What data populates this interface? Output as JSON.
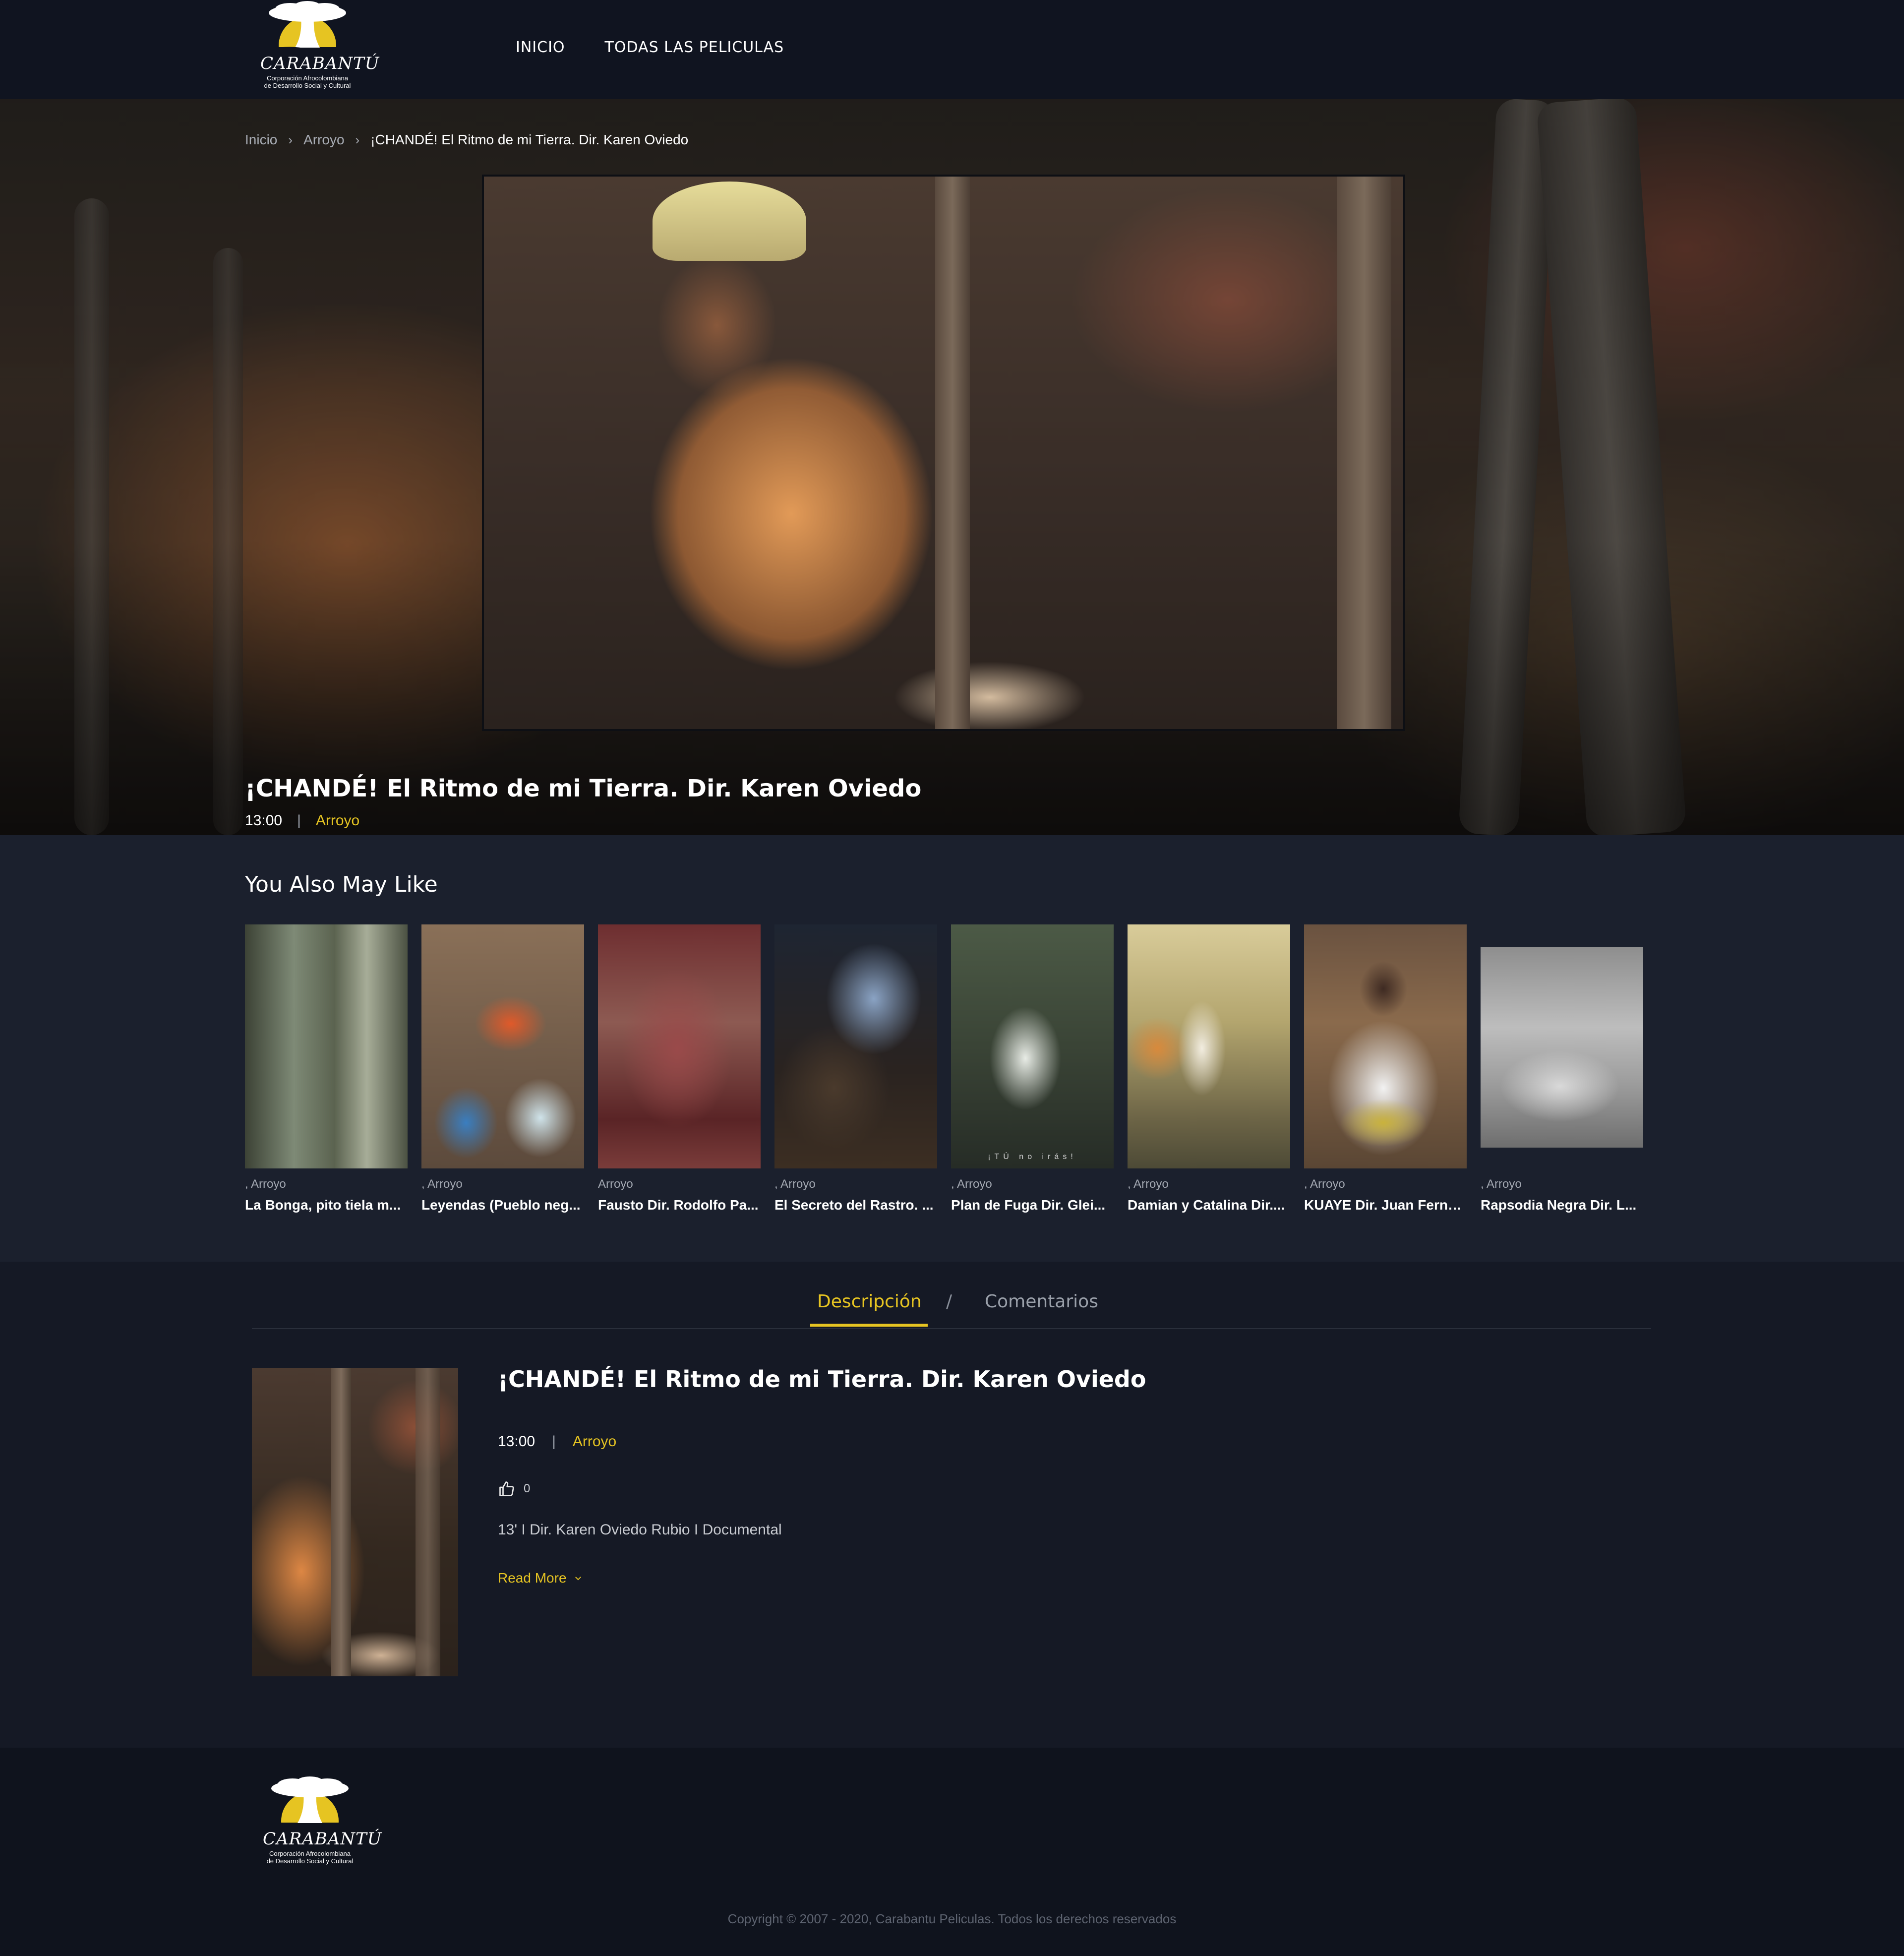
{
  "brand": {
    "name": "CARABANTÚ",
    "tagline_line1": "Corporación Afrocolombiana",
    "tagline_line2": "de Desarrollo Social y Cultural"
  },
  "nav": {
    "items": [
      "INICIO",
      "TODAS LAS PELICULAS"
    ]
  },
  "breadcrumb": {
    "items": [
      "Inicio",
      "Arroyo",
      "¡CHANDÉ! El Ritmo de mi Tierra. Dir. Karen Oviedo"
    ],
    "separator": "›"
  },
  "hero": {
    "title": "¡CHANDÉ! El Ritmo de mi Tierra. Dir. Karen Oviedo",
    "duration": "13:00",
    "separator": "|",
    "category": "Arroyo"
  },
  "related": {
    "heading": "You Also May Like",
    "items": [
      {
        "category": ", Arroyo",
        "title": "La Bonga, pito tiela m..."
      },
      {
        "category": ", Arroyo",
        "title": "Leyendas (Pueblo neg..."
      },
      {
        "category": "Arroyo",
        "title": "Fausto Dir. Rodolfo Pa..."
      },
      {
        "category": ", Arroyo",
        "title": "El Secreto del Rastro. ..."
      },
      {
        "category": ", Arroyo",
        "title": "Plan de Fuga Dir. Glei..."
      },
      {
        "category": ", Arroyo",
        "title": "Damian y Catalina Dir...."
      },
      {
        "category": ", Arroyo",
        "title": "KUAYE Dir. Juan Ferna..."
      },
      {
        "category": ", Arroyo",
        "title": "Rapsodia Negra Dir. L..."
      }
    ],
    "overlay_text": "¡TÚ no irás!"
  },
  "tabs": {
    "active": "Descripción",
    "separator": "/",
    "other": "Comentarios"
  },
  "description": {
    "title": "¡CHANDÉ! El Ritmo de mi Tierra. Dir. Karen Oviedo",
    "duration": "13:00",
    "separator": "|",
    "category": "Arroyo",
    "likes": "0",
    "text": "13' I Dir. Karen Oviedo Rubio I Documental",
    "read_more": "Read More",
    "read_more_icon": "chevron-down-icon"
  },
  "footer": {
    "copyright": "Copyright © 2007 - 2020, Carabantu Peliculas. Todos los derechos reservados"
  },
  "colors": {
    "accent": "#e6c422",
    "header_bg": "#101420",
    "page_bg": "#151925",
    "related_bg": "#1b202d",
    "footer_bg": "#0f131d"
  }
}
